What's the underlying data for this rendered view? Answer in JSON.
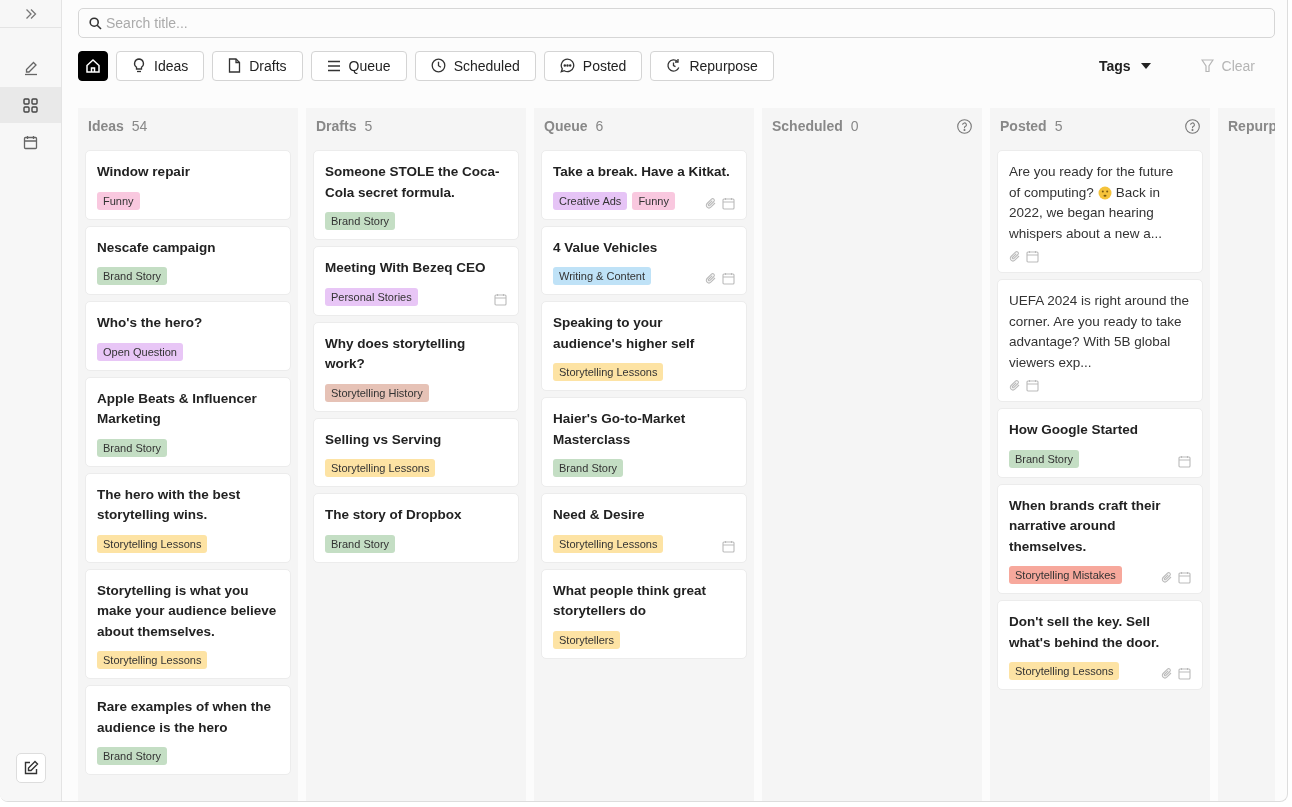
{
  "sidebar": {
    "items": [
      {
        "kind": "pen",
        "selected": false
      },
      {
        "kind": "grid",
        "selected": true
      },
      {
        "kind": "calendar",
        "selected": false
      }
    ]
  },
  "search": {
    "placeholder": "Search title..."
  },
  "filters": [
    {
      "kind": "home",
      "selected": true
    },
    {
      "kind": "bulb",
      "label": "Ideas",
      "selected": false
    },
    {
      "kind": "file",
      "label": "Drafts",
      "selected": false
    },
    {
      "kind": "list",
      "label": "Queue",
      "selected": false
    },
    {
      "kind": "clock",
      "label": "Scheduled",
      "selected": false
    },
    {
      "kind": "chat",
      "label": "Posted",
      "selected": false
    },
    {
      "kind": "repeat",
      "label": "Repurpose",
      "selected": false
    }
  ],
  "tags_dropdown": {
    "label": "Tags"
  },
  "clear_button": {
    "label": "Clear",
    "disabled": true
  },
  "columns": [
    {
      "title": "Ideas",
      "count": "54",
      "help": false,
      "cards": [
        {
          "kind": "title",
          "text": "Window repair",
          "tags": [
            {
              "label": "Funny",
              "color": "#f9c8df"
            }
          ],
          "attachment": false,
          "calendar": false
        },
        {
          "kind": "title",
          "text": "Nescafe campaign",
          "tags": [
            {
              "label": "Brand Story",
              "color": "#c4dec4"
            }
          ],
          "attachment": false,
          "calendar": false
        },
        {
          "kind": "title",
          "text": "Who's the hero?",
          "tags": [
            {
              "label": "Open Question",
              "color": "#e8c6f6"
            }
          ],
          "attachment": false,
          "calendar": false
        },
        {
          "kind": "title",
          "text": "Apple Beats & Influencer Marketing",
          "tags": [
            {
              "label": "Brand Story",
              "color": "#c4dec4"
            }
          ],
          "attachment": false,
          "calendar": false
        },
        {
          "kind": "title",
          "text": "The hero with the best storytelling wins.",
          "tags": [
            {
              "label": "Storytelling Lessons",
              "color": "#fde3a4"
            }
          ],
          "attachment": false,
          "calendar": false
        },
        {
          "kind": "title",
          "text": "Storytelling is what you make your audience believe about themselves.",
          "tags": [
            {
              "label": "Storytelling Lessons",
              "color": "#fde3a4"
            }
          ],
          "attachment": false,
          "calendar": false
        },
        {
          "kind": "title",
          "text": "Rare examples of when the audience is the hero",
          "tags": [
            {
              "label": "Brand Story",
              "color": "#c4dec4"
            }
          ],
          "attachment": false,
          "calendar": false
        }
      ]
    },
    {
      "title": "Drafts",
      "count": "5",
      "help": false,
      "cards": [
        {
          "kind": "title",
          "text": "Someone STOLE the Coca-Cola secret formula.",
          "tags": [
            {
              "label": "Brand Story",
              "color": "#c4dec4"
            }
          ],
          "attachment": false,
          "calendar": false
        },
        {
          "kind": "title",
          "text": "Meeting With Bezeq CEO",
          "tags": [
            {
              "label": "Personal Stories",
              "color": "#e8c6f6"
            }
          ],
          "attachment": false,
          "calendar": true
        },
        {
          "kind": "title",
          "text": "Why does storytelling work?",
          "tags": [
            {
              "label": "Storytelling History",
              "color": "#e6c2b6"
            }
          ],
          "attachment": false,
          "calendar": false
        },
        {
          "kind": "title",
          "text": "Selling vs Serving",
          "tags": [
            {
              "label": "Storytelling Lessons",
              "color": "#fde3a4"
            }
          ],
          "attachment": false,
          "calendar": false
        },
        {
          "kind": "title",
          "text": "The story of Dropbox",
          "tags": [
            {
              "label": "Brand Story",
              "color": "#c4dec4"
            }
          ],
          "attachment": false,
          "calendar": false
        }
      ]
    },
    {
      "title": "Queue",
      "count": "6",
      "help": false,
      "cards": [
        {
          "kind": "title",
          "text": "Take a break. Have a Kitkat.",
          "tags": [
            {
              "label": "Creative Ads",
              "color": "#e6c4f6"
            },
            {
              "label": "Funny",
              "color": "#f9c8df"
            }
          ],
          "attachment": true,
          "calendar": true
        },
        {
          "kind": "title",
          "text": "4 Value Vehicles",
          "tags": [
            {
              "label": "Writing & Content",
              "color": "#bfe2f7"
            }
          ],
          "attachment": true,
          "calendar": true
        },
        {
          "kind": "title",
          "text": "Speaking to your audience's higher self",
          "tags": [
            {
              "label": "Storytelling Lessons",
              "color": "#fde3a4"
            }
          ],
          "attachment": false,
          "calendar": false
        },
        {
          "kind": "title",
          "text": "Haier's Go-to-Market Masterclass",
          "tags": [
            {
              "label": "Brand Story",
              "color": "#c4dec4"
            }
          ],
          "attachment": false,
          "calendar": false
        },
        {
          "kind": "title",
          "text": "Need & Desire",
          "tags": [
            {
              "label": "Storytelling Lessons",
              "color": "#fde3a4"
            }
          ],
          "attachment": false,
          "calendar": true
        },
        {
          "kind": "title",
          "text": "What people think great storytellers do",
          "tags": [
            {
              "label": "Storytellers",
              "color": "#fde3a4"
            }
          ],
          "attachment": false,
          "calendar": false
        }
      ]
    },
    {
      "title": "Scheduled",
      "count": "0",
      "help": true
    },
    {
      "title": "Posted",
      "count": "5",
      "help": true,
      "cards": [
        {
          "kind": "excerpt",
          "lines": [
            {
              "parts": [
                {
                  "kind": "text",
                  "text": "Are you ready for the future"
                }
              ]
            },
            {
              "parts": [
                {
                  "kind": "text",
                  "text": "of computing?"
                },
                {
                  "kind": "emoji"
                },
                {
                  "kind": "text",
                  "text": "Back in"
                }
              ]
            },
            {
              "parts": [
                {
                  "kind": "text",
                  "text": "2022, we began hearing whispers about a new a..."
                }
              ]
            }
          ],
          "attachment": true,
          "calendar": true
        },
        {
          "kind": "excerpt",
          "lines": [
            {
              "parts": [
                {
                  "kind": "text",
                  "text": "UEFA 2024 is right around the corner. Are you ready to take advantage? With 5B global viewers exp..."
                }
              ]
            }
          ],
          "attachment": true,
          "calendar": true
        },
        {
          "kind": "title",
          "text": "How Google Started",
          "tags": [
            {
              "label": "Brand Story",
              "color": "#c4dec4"
            }
          ],
          "attachment": false,
          "calendar": true
        },
        {
          "kind": "title",
          "text": "When brands craft their narrative around themselves.",
          "tags": [
            {
              "label": "Storytelling Mistakes",
              "color": "#f7a89c"
            }
          ],
          "attachment": true,
          "calendar": true
        },
        {
          "kind": "title",
          "text": "Don't sell the key. Sell what's behind the door.",
          "tags": [
            {
              "label": "Storytelling Lessons",
              "color": "#fde3a4"
            }
          ],
          "attachment": true,
          "calendar": true
        }
      ]
    },
    {
      "title": "Repurp",
      "help": false
    }
  ]
}
